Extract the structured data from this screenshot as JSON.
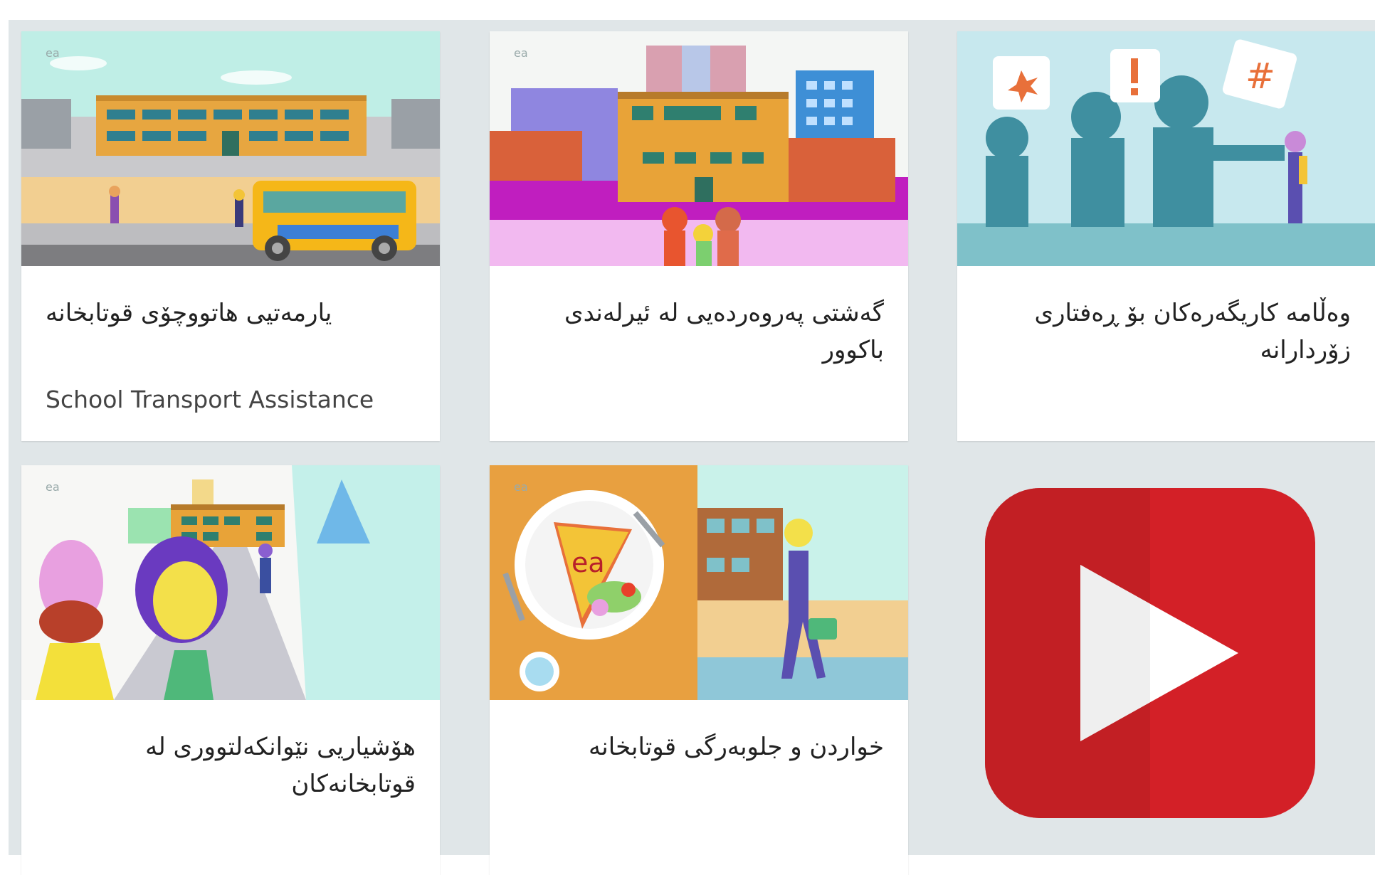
{
  "colors": {
    "page_background": "#e0e6e8",
    "card_background": "#ffffff",
    "title_text": "#222222",
    "youtube_red": "#d32027",
    "youtube_dark_red": "#c21f24"
  },
  "cards": [
    {
      "title": "یارمەتیی هاتووچۆی قوتابخانە",
      "subtitle": "School Transport Assistance",
      "thumbnail_icon": "school-bus-illustration"
    },
    {
      "title": "گەشتی پەروەردەیی لە ئیرلەندی باکوور",
      "thumbnail_icon": "school-buildings-illustration"
    },
    {
      "title": "وەڵامە کاریگەرەکان بۆ ڕەفتاری زۆردارانە",
      "thumbnail_icon": "bullying-illustration"
    },
    {
      "title": "هۆشیاریی نێوانکەلتووری لە قوتابخانەکان",
      "thumbnail_icon": "intercultural-illustration"
    },
    {
      "title": "خواردن و جلوبەرگی قوتابخانە",
      "thumbnail_icon": "school-lunch-illustration"
    }
  ],
  "youtube": {
    "icon": "youtube-play-icon"
  }
}
